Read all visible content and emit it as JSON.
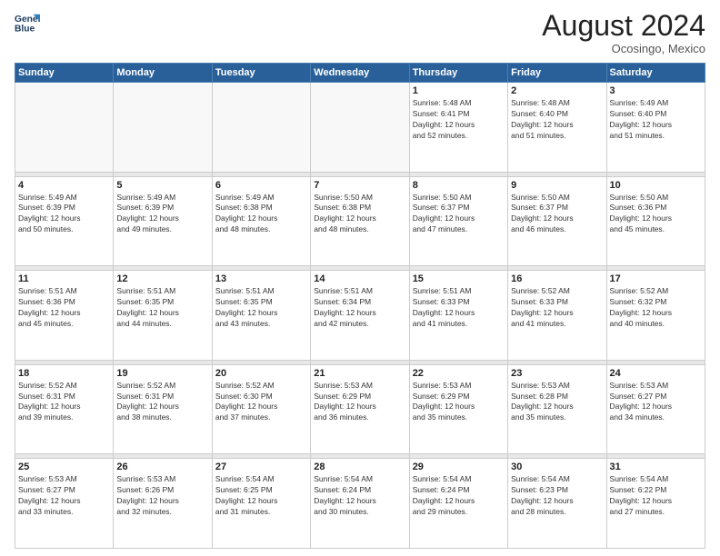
{
  "header": {
    "logo_line1": "General",
    "logo_line2": "Blue",
    "month_title": "August 2024",
    "location": "Ocosingo, Mexico"
  },
  "weekdays": [
    "Sunday",
    "Monday",
    "Tuesday",
    "Wednesday",
    "Thursday",
    "Friday",
    "Saturday"
  ],
  "weeks": [
    [
      {
        "day": "",
        "info": ""
      },
      {
        "day": "",
        "info": ""
      },
      {
        "day": "",
        "info": ""
      },
      {
        "day": "",
        "info": ""
      },
      {
        "day": "1",
        "info": "Sunrise: 5:48 AM\nSunset: 6:41 PM\nDaylight: 12 hours\nand 52 minutes."
      },
      {
        "day": "2",
        "info": "Sunrise: 5:48 AM\nSunset: 6:40 PM\nDaylight: 12 hours\nand 51 minutes."
      },
      {
        "day": "3",
        "info": "Sunrise: 5:49 AM\nSunset: 6:40 PM\nDaylight: 12 hours\nand 51 minutes."
      }
    ],
    [
      {
        "day": "4",
        "info": "Sunrise: 5:49 AM\nSunset: 6:39 PM\nDaylight: 12 hours\nand 50 minutes."
      },
      {
        "day": "5",
        "info": "Sunrise: 5:49 AM\nSunset: 6:39 PM\nDaylight: 12 hours\nand 49 minutes."
      },
      {
        "day": "6",
        "info": "Sunrise: 5:49 AM\nSunset: 6:38 PM\nDaylight: 12 hours\nand 48 minutes."
      },
      {
        "day": "7",
        "info": "Sunrise: 5:50 AM\nSunset: 6:38 PM\nDaylight: 12 hours\nand 48 minutes."
      },
      {
        "day": "8",
        "info": "Sunrise: 5:50 AM\nSunset: 6:37 PM\nDaylight: 12 hours\nand 47 minutes."
      },
      {
        "day": "9",
        "info": "Sunrise: 5:50 AM\nSunset: 6:37 PM\nDaylight: 12 hours\nand 46 minutes."
      },
      {
        "day": "10",
        "info": "Sunrise: 5:50 AM\nSunset: 6:36 PM\nDaylight: 12 hours\nand 45 minutes."
      }
    ],
    [
      {
        "day": "11",
        "info": "Sunrise: 5:51 AM\nSunset: 6:36 PM\nDaylight: 12 hours\nand 45 minutes."
      },
      {
        "day": "12",
        "info": "Sunrise: 5:51 AM\nSunset: 6:35 PM\nDaylight: 12 hours\nand 44 minutes."
      },
      {
        "day": "13",
        "info": "Sunrise: 5:51 AM\nSunset: 6:35 PM\nDaylight: 12 hours\nand 43 minutes."
      },
      {
        "day": "14",
        "info": "Sunrise: 5:51 AM\nSunset: 6:34 PM\nDaylight: 12 hours\nand 42 minutes."
      },
      {
        "day": "15",
        "info": "Sunrise: 5:51 AM\nSunset: 6:33 PM\nDaylight: 12 hours\nand 41 minutes."
      },
      {
        "day": "16",
        "info": "Sunrise: 5:52 AM\nSunset: 6:33 PM\nDaylight: 12 hours\nand 41 minutes."
      },
      {
        "day": "17",
        "info": "Sunrise: 5:52 AM\nSunset: 6:32 PM\nDaylight: 12 hours\nand 40 minutes."
      }
    ],
    [
      {
        "day": "18",
        "info": "Sunrise: 5:52 AM\nSunset: 6:31 PM\nDaylight: 12 hours\nand 39 minutes."
      },
      {
        "day": "19",
        "info": "Sunrise: 5:52 AM\nSunset: 6:31 PM\nDaylight: 12 hours\nand 38 minutes."
      },
      {
        "day": "20",
        "info": "Sunrise: 5:52 AM\nSunset: 6:30 PM\nDaylight: 12 hours\nand 37 minutes."
      },
      {
        "day": "21",
        "info": "Sunrise: 5:53 AM\nSunset: 6:29 PM\nDaylight: 12 hours\nand 36 minutes."
      },
      {
        "day": "22",
        "info": "Sunrise: 5:53 AM\nSunset: 6:29 PM\nDaylight: 12 hours\nand 35 minutes."
      },
      {
        "day": "23",
        "info": "Sunrise: 5:53 AM\nSunset: 6:28 PM\nDaylight: 12 hours\nand 35 minutes."
      },
      {
        "day": "24",
        "info": "Sunrise: 5:53 AM\nSunset: 6:27 PM\nDaylight: 12 hours\nand 34 minutes."
      }
    ],
    [
      {
        "day": "25",
        "info": "Sunrise: 5:53 AM\nSunset: 6:27 PM\nDaylight: 12 hours\nand 33 minutes."
      },
      {
        "day": "26",
        "info": "Sunrise: 5:53 AM\nSunset: 6:26 PM\nDaylight: 12 hours\nand 32 minutes."
      },
      {
        "day": "27",
        "info": "Sunrise: 5:54 AM\nSunset: 6:25 PM\nDaylight: 12 hours\nand 31 minutes."
      },
      {
        "day": "28",
        "info": "Sunrise: 5:54 AM\nSunset: 6:24 PM\nDaylight: 12 hours\nand 30 minutes."
      },
      {
        "day": "29",
        "info": "Sunrise: 5:54 AM\nSunset: 6:24 PM\nDaylight: 12 hours\nand 29 minutes."
      },
      {
        "day": "30",
        "info": "Sunrise: 5:54 AM\nSunset: 6:23 PM\nDaylight: 12 hours\nand 28 minutes."
      },
      {
        "day": "31",
        "info": "Sunrise: 5:54 AM\nSunset: 6:22 PM\nDaylight: 12 hours\nand 27 minutes."
      }
    ]
  ]
}
